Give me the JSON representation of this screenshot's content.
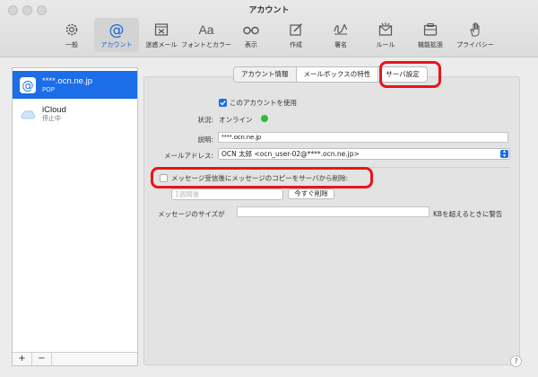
{
  "window": {
    "title": "アカウント"
  },
  "toolbar": {
    "items": [
      {
        "label": "一般",
        "icon": "gear-icon"
      },
      {
        "label": "アカウント",
        "icon": "at-icon"
      },
      {
        "label": "迷惑メール",
        "icon": "junk-icon"
      },
      {
        "label": "フォントとカラー",
        "icon": "font-icon",
        "glyph": "Aa"
      },
      {
        "label": "表示",
        "icon": "glasses-icon"
      },
      {
        "label": "作成",
        "icon": "compose-icon"
      },
      {
        "label": "署名",
        "icon": "signature-icon"
      },
      {
        "label": "ルール",
        "icon": "rules-icon"
      },
      {
        "label": "機能拡張",
        "icon": "extensions-icon"
      },
      {
        "label": "プライバシー",
        "icon": "privacy-hand-icon"
      }
    ],
    "active_index": 1
  },
  "sidebar": {
    "accounts": [
      {
        "name": "****.ocn.ne.jp",
        "sub": "POP",
        "icon": "at-icon",
        "selected": true
      },
      {
        "name": "iCloud",
        "sub": "停止中",
        "icon": "cloud-icon",
        "selected": false
      }
    ],
    "add_label": "+",
    "remove_label": "−"
  },
  "tabs": {
    "items": [
      "アカウント情報",
      "メールボックスの特性",
      "サーバ設定"
    ],
    "selected": "アカウント情報"
  },
  "form": {
    "enable_label": "このアカウントを使用",
    "enable_checked": true,
    "status_label": "状況:",
    "status_value": "オンライン",
    "status_color": "#2dbd3a",
    "description_label": "説明:",
    "description_value": "****.ocn.ne.jp",
    "email_label": "メールアドレス:",
    "email_value": "OCN 太郎 <ocn_user-02@****.ocn.ne.jp>",
    "delete_copy_label": "メッセージ受信後にメッセージのコピーをサーバから削除:",
    "delete_copy_checked": false,
    "delete_period": "1週間後",
    "delete_now_label": "今すぐ削除",
    "size_label": "メッセージのサイズが",
    "size_value": "",
    "size_suffix": "KBを超えるときに警告"
  },
  "colors": {
    "accent": "#1c6de8",
    "highlight": "#e8151b"
  }
}
